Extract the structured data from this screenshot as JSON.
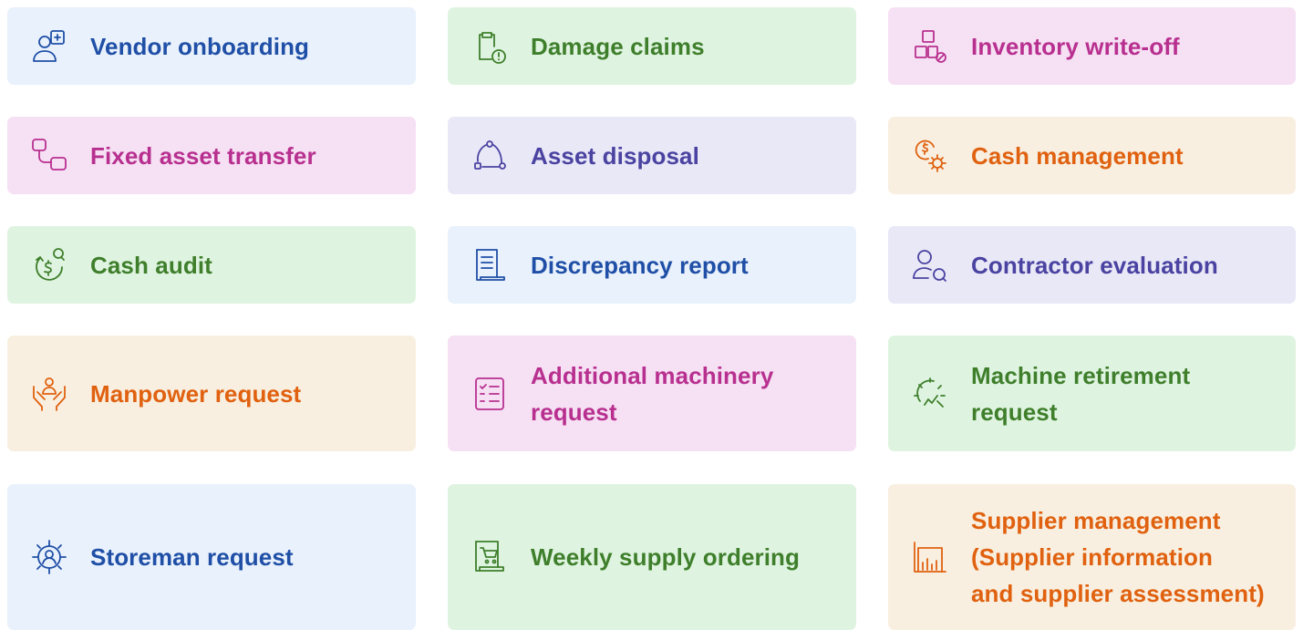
{
  "cards": [
    {
      "label": "Vendor onboarding",
      "icon": "user-add-icon",
      "theme": "blue"
    },
    {
      "label": "Damage claims",
      "icon": "clipboard-alert-icon",
      "theme": "green"
    },
    {
      "label": "Inventory write-off",
      "icon": "boxes-blocked-icon",
      "theme": "pink"
    },
    {
      "label": "Fixed asset transfer",
      "icon": "transfer-flow-icon",
      "theme": "pink"
    },
    {
      "label": "Asset disposal",
      "icon": "cycle-nodes-icon",
      "theme": "violet"
    },
    {
      "label": "Cash management",
      "icon": "coin-gear-icon",
      "theme": "cream"
    },
    {
      "label": "Cash audit",
      "icon": "coin-refresh-search-icon",
      "theme": "green"
    },
    {
      "label": "Discrepancy report",
      "icon": "document-report-icon",
      "theme": "blue"
    },
    {
      "label": "Contractor evaluation",
      "icon": "user-search-icon",
      "theme": "violet"
    },
    {
      "label": "Manpower request",
      "icon": "hands-person-icon",
      "theme": "cream"
    },
    {
      "label": "Additional machinery\nrequest",
      "icon": "checklist-icon",
      "theme": "pink"
    },
    {
      "label": "Machine retirement\nrequest",
      "icon": "broken-gear-icon",
      "theme": "green"
    },
    {
      "label": "Storeman request",
      "icon": "user-gear-icon",
      "theme": "blue"
    },
    {
      "label": "Weekly supply ordering",
      "icon": "cart-document-icon",
      "theme": "green"
    },
    {
      "label": "Supplier management\n(Supplier information\nand supplier assessment)",
      "icon": "bar-chart-icon",
      "theme": "cream"
    }
  ],
  "colors": {
    "blue": "#1f4fa6",
    "green": "#3f7f2c",
    "pink": "#b8308f",
    "violet": "#4a43a1",
    "orange": "#e0610f"
  }
}
